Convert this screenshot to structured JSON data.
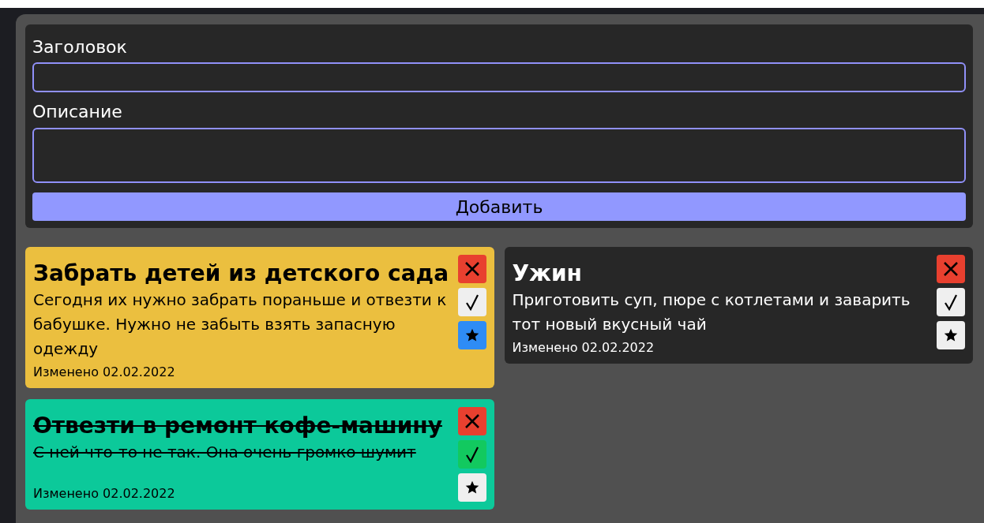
{
  "form": {
    "title_label": "Заголовок",
    "description_label": "Описание",
    "submit": "Добавить"
  },
  "notes": [
    {
      "title": "Забрать детей из детского сада",
      "description": "Сегодня их нужно забрать пораньше и отвезти к бабушке. Нужно не забыть взять запасную одежду",
      "modified": "Изменено 02.02.2022",
      "done": false,
      "starred": true
    },
    {
      "title": "Ужин",
      "description": "Приготовить суп, пюре с котлетами и заварить тот новый вкусный чай",
      "modified": "Изменено 02.02.2022",
      "done": false,
      "starred": false
    },
    {
      "title": "Отвезти в ремонт кофе-машину",
      "description": "С ней что-то не так. Она очень громко шумит",
      "modified": "Изменено 02.02.2022",
      "done": true,
      "starred": false
    }
  ]
}
